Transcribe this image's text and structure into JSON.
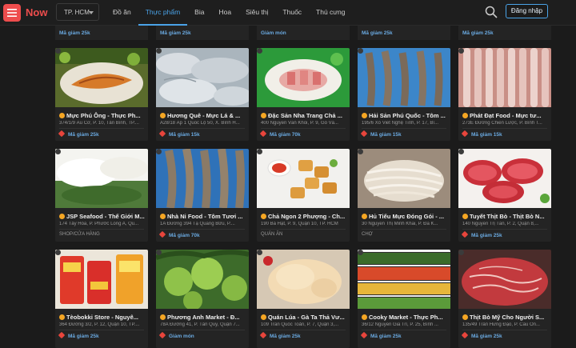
{
  "header": {
    "logo_text": "Now",
    "city": "TP. HCM",
    "nav": [
      {
        "label": "Đồ ăn",
        "active": false
      },
      {
        "label": "Thực phẩm",
        "active": true
      },
      {
        "label": "Bia",
        "active": false
      },
      {
        "label": "Hoa",
        "active": false
      },
      {
        "label": "Siêu thị",
        "active": false
      },
      {
        "label": "Thuốc",
        "active": false
      },
      {
        "label": "Thú cưng",
        "active": false
      }
    ],
    "login_label": "Đăng nhập"
  },
  "top_strip": [
    "Mã giảm 25k",
    "Mã giảm 25k",
    "Giảm món",
    "Mã giảm 25k",
    "Mã giảm 25k"
  ],
  "rows": [
    [
      {
        "title": "Mực Phú Ông - Thực Ph...",
        "addr": "374/1/9 Âu Cơ, P. 10, Tân Bình, TP....",
        "promo": "Mã giảm 25k"
      },
      {
        "title": "Hương Quê - Mực Lá & ...",
        "addr": "A28/18 Ấp 1 Quốc Lộ 50, X. Bình H...",
        "promo": "Mã giảm 15k"
      },
      {
        "title": "Đặc Sản Nha Trang Chả ...",
        "addr": "400 Nguyễn Văn Khối, P. 9, Gò Vấ...",
        "promo": "Mã giảm 70k"
      },
      {
        "title": "Hải Sản Phú Quốc - Tôm ...",
        "addr": "195/6 Xô Viết Nghệ Tĩnh, P. 17, Bì...",
        "promo": "Mã giảm 15k"
      },
      {
        "title": "Phát Đạt Food - Mực tư...",
        "addr": "273E Đường Chiến Lược, P. Bình T...",
        "promo": "Mã giảm 15k"
      }
    ],
    [
      {
        "title": "JSP Seafood - Thế Giới M...",
        "addr": "174 Tây Hòa, P. Phước Long A, Qu...",
        "cat": "SHOP/CỬA HÀNG"
      },
      {
        "title": "Nhà Ni Food - Tôm Tươi ...",
        "addr": "1A Đường 394 Tạ Quang Bửu, P....",
        "promo": "Mã giảm 70k"
      },
      {
        "title": "Chả Ngon 2 Phượng - Ch...",
        "addr": "190 Bà Hạt, P. 9, Quận 10, TP. HCM",
        "cat": "QUÁN ĂN"
      },
      {
        "title": "Hủ Tiếu Mực Đóng Gói - ...",
        "addr": "30 Nguyễn Thị Minh Khai, P. Đa K...",
        "cat": "CHỢ"
      },
      {
        "title": "Tuyết Thịt Bò - Thịt Bò N...",
        "addr": "140 Nguyễn Trị Tấn, P. 2, Quận 8,...",
        "promo": "Mã giảm 25k"
      }
    ],
    [
      {
        "title": "Tèobokki Store - Nguyê...",
        "addr": "364 Đường 3/2, P. 12, Quận 10, TP....",
        "promo": "Mã giảm 25k"
      },
      {
        "title": "Phương Anh Market - Đ...",
        "addr": "78A Đường 41, P. Tân Quy, Quận 7...",
        "promo": "Giảm món"
      },
      {
        "title": "Quán Lúa - Gà Ta Thả Vư...",
        "addr": "109 Trần Quốc Toản, P. 7, Quận 3,...",
        "promo": "Mã giảm 25k"
      },
      {
        "title": "Cooky Market - Thực Ph...",
        "addr": "36/12 Nguyễn Gia Trí, P. 25, Bình ...",
        "promo": "Mã giảm 25k"
      },
      {
        "title": "Thịt Bò Mỹ Cho Người S...",
        "addr": "135/49 Trần Hưng Đạo, P. Cầu Ôn...",
        "promo": "Mã giảm 25k"
      }
    ]
  ],
  "colors": {
    "accent": "#4aa3e8",
    "brand": "#ee4d4d",
    "verified": "#f5a623",
    "promo": "#6aa9e0"
  }
}
